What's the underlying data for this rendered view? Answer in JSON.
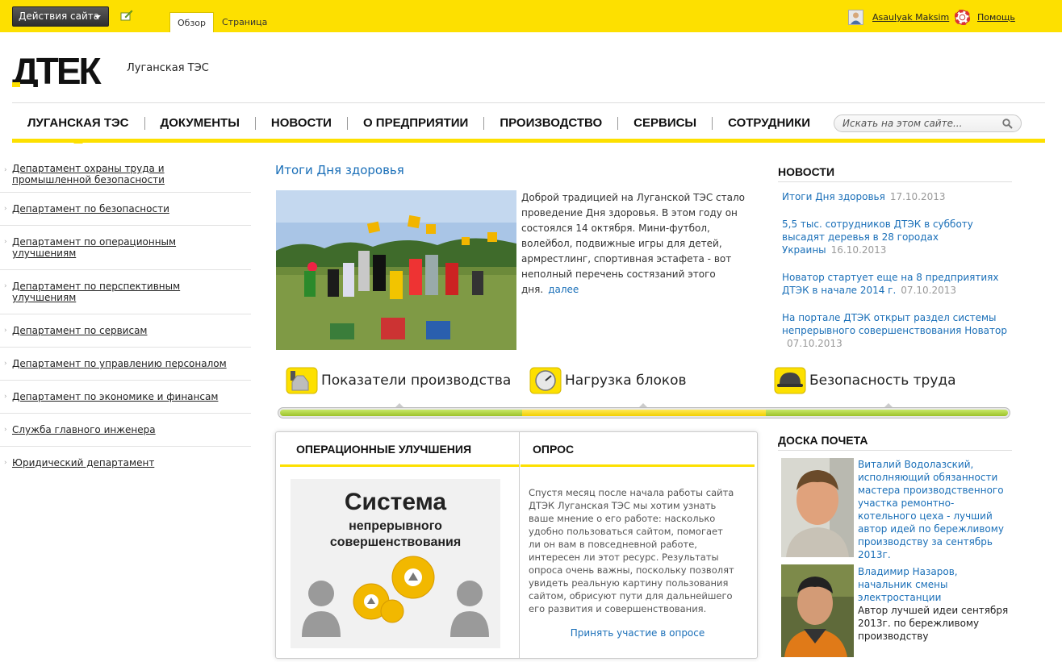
{
  "ribbon": {
    "site_actions_label": "Действия сайта",
    "tabs": [
      {
        "label": "Обзор",
        "active": true
      },
      {
        "label": "Страница",
        "active": false
      }
    ],
    "user_name": "Asaulyak Maksim",
    "help_label": "Помощь"
  },
  "header": {
    "logo_text": "ДТЕК",
    "site_title": "Луганская ТЭС"
  },
  "nav": {
    "items": [
      {
        "label": "ЛУГАНСКАЯ ТЭС",
        "active": true
      },
      {
        "label": "ДОКУМЕНТЫ",
        "active": false
      },
      {
        "label": "НОВОСТИ",
        "active": false
      },
      {
        "label": "О ПРЕДПРИЯТИИ",
        "active": false
      },
      {
        "label": "ПРОИЗВОДСТВО",
        "active": false
      },
      {
        "label": "СЕРВИСЫ",
        "active": false
      },
      {
        "label": "СОТРУДНИКИ",
        "active": false
      }
    ],
    "search_placeholder": "Искать на этом сайте..."
  },
  "sidebar": {
    "items": [
      "Департамент охраны труда и промышленной безопасности",
      "Департамент по безопасности",
      "Департамент по операционным улучшениям",
      "Департамент по перспективным улучшениям",
      "Департамент по сервисам",
      "Департамент по управлению персоналом",
      "Департамент по экономике и финансам",
      "Служба главного инженера",
      "Юридический департамент"
    ]
  },
  "feature": {
    "title": "Итоги Дня здоровья",
    "text": "Доброй традицией на Луганской ТЭС стало проведение Дня здоровья. В этом году он состоялся 14 октября. Мини-футбол, волейбол, подвижные игры для детей, армрестлинг, спортивная эстафета - вот неполный перечень состязаний этого дня.",
    "more_label": "далее"
  },
  "news": {
    "heading": "НОВОСТИ",
    "items": [
      {
        "title": "Итоги Дня здоровья",
        "date": "17.10.2013"
      },
      {
        "title": "5,5 тыс. сотрудников ДТЭК в субботу высадят деревья в 28 городах Украины",
        "date": "16.10.2013"
      },
      {
        "title": "Новатор стартует еще на 8 предприятиях ДТЭК в начале 2014 г.",
        "date": "07.10.2013"
      },
      {
        "title": "На портале ДТЭК открыт раздел системы непрерывного совершенствования Новатор",
        "date": "07.10.2013"
      }
    ]
  },
  "tabs": {
    "items": [
      {
        "label": "Показатели производства",
        "icon": "factory-icon"
      },
      {
        "label": "Нагрузка блоков",
        "icon": "gauge-icon"
      },
      {
        "label": "Безопасность труда",
        "icon": "hardhat-icon"
      }
    ],
    "colors": {
      "green": "#a6cf33",
      "yellow": "#fde000"
    }
  },
  "operational": {
    "heading": "ОПЕРАЦИОННЫЕ УЛУЧШЕНИЯ",
    "banner_title": "Система",
    "banner_line1": "непрерывного",
    "banner_line2": "совершенствования"
  },
  "poll": {
    "heading": "ОПРОС",
    "text": "Спустя месяц после начала работы сайта ДТЭК Луганская ТЭС мы хотим узнать ваше мнение о его работе: насколько удобно пользоваться сайтом, помогает ли он вам в повседневной работе, интересен ли этот ресурс. Результаты опроса очень важны, поскольку позволят увидеть реальную картину пользования сайтом, обрисуют пути для дальнейшего его развития и совершенствования.",
    "link_label": "Принять участие в опросе"
  },
  "honor": {
    "heading": "ДОСКА ПОЧЕТА",
    "items": [
      {
        "link": "Виталий Водолазский, исполняющий обязанности мастера производственного участка ремонтно-котельного цеха - лучший автор идей по бережливому производству за сентябрь 2013г.",
        "note": ""
      },
      {
        "link": "Владимир Назаров, начальник смены электростанции",
        "note": "Автор лучшей идеи сентября 2013г. по бережливому производству"
      }
    ]
  },
  "colors": {
    "brand_yellow": "#fde000",
    "link_blue": "#1a6fb8"
  }
}
